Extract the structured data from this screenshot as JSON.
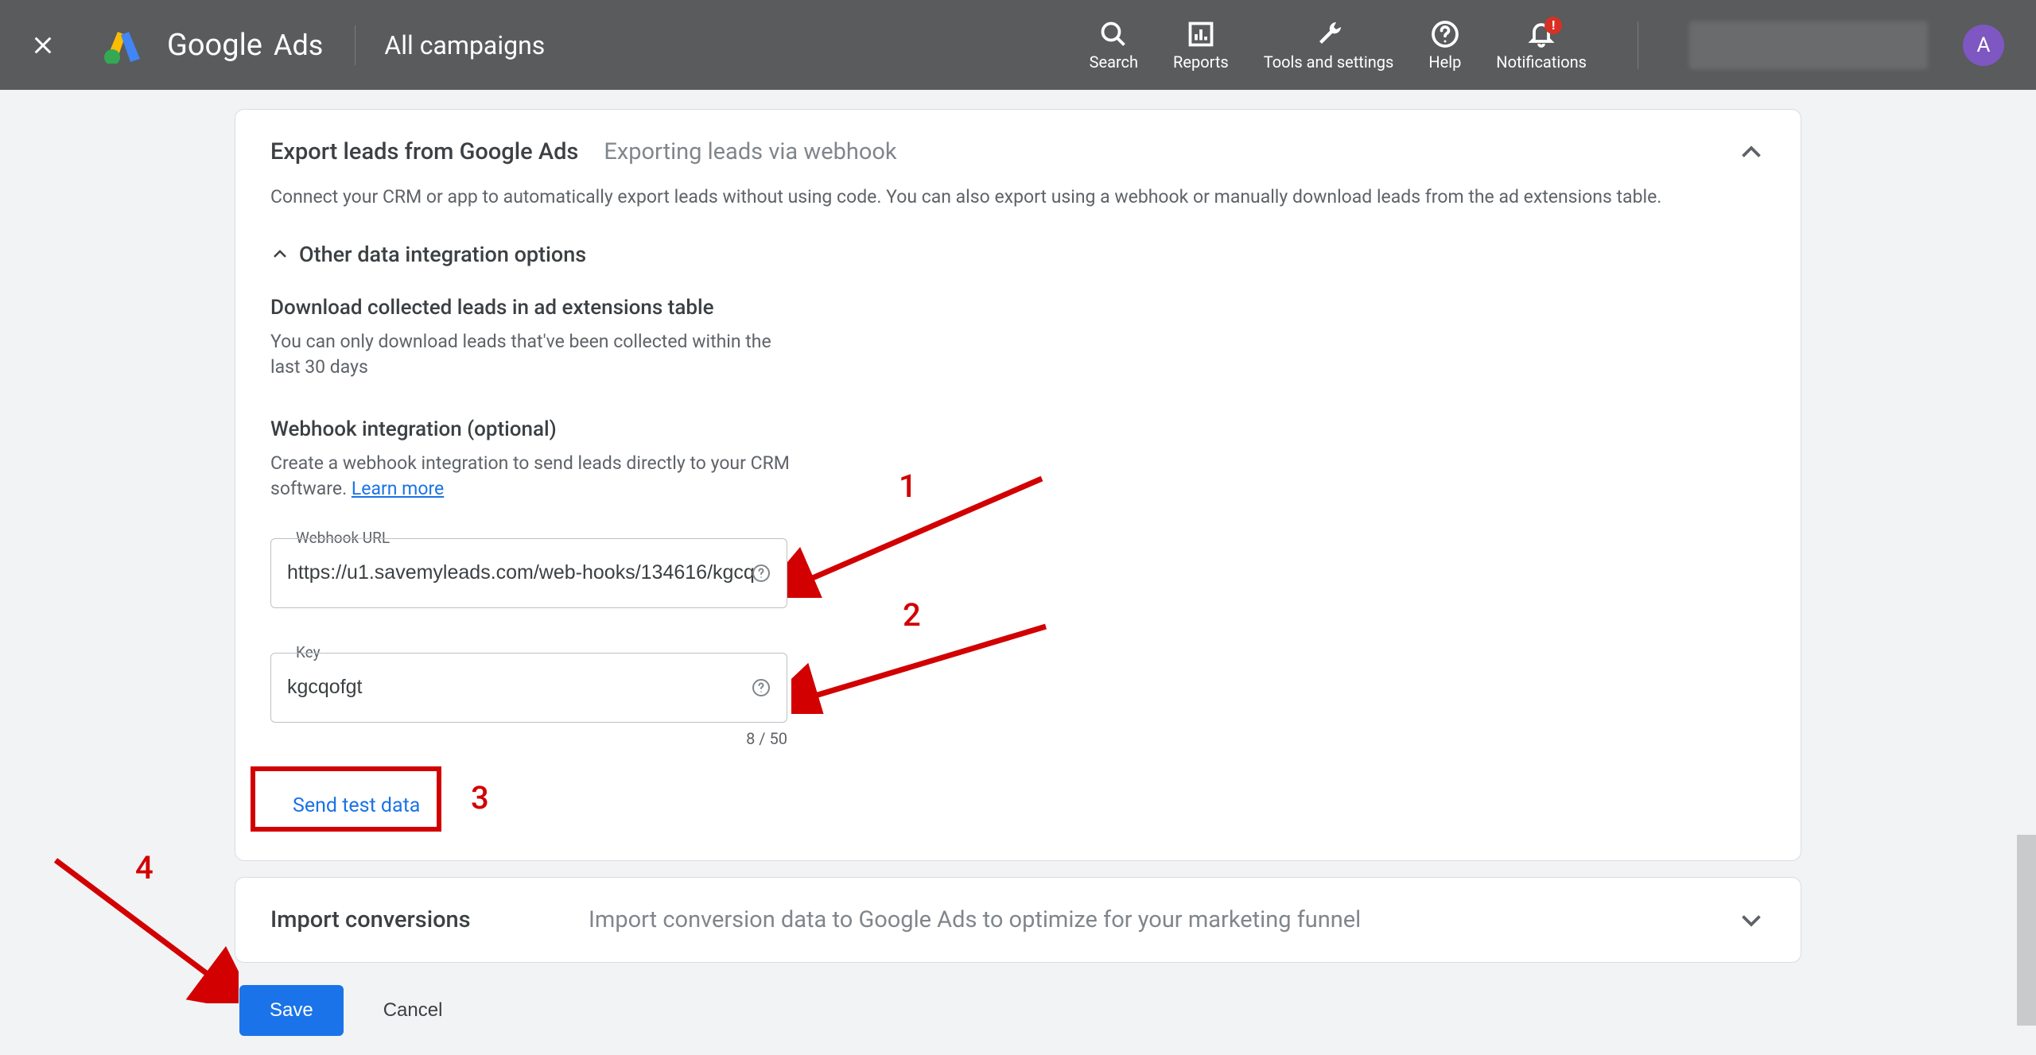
{
  "header": {
    "logo_google": "Google",
    "logo_ads": "Ads",
    "all_campaigns": "All campaigns",
    "items": {
      "search": "Search",
      "reports": "Reports",
      "tools": "Tools and settings",
      "help": "Help",
      "notifications": "Notifications",
      "notif_badge": "!"
    },
    "avatar": "A"
  },
  "card": {
    "title": "Export leads from Google Ads",
    "subtitle": "Exporting leads via webhook",
    "desc": "Connect your CRM or app to automatically export leads without using code. You can also export using a webhook or manually download leads from the ad extensions table.",
    "other_options": "Other data integration options",
    "download_heading": "Download collected leads in ad extensions table",
    "download_desc": "You can only download leads that've been collected within the last 30 days",
    "webhook_heading": "Webhook integration (optional)",
    "webhook_desc_pre": "Create a webhook integration to send leads directly to your CRM software. ",
    "learn_more": "Learn more",
    "webhook_url_label": "Webhook URL",
    "webhook_url_value": "https://u1.savemyleads.com/web-hooks/134616/kgcq",
    "key_label": "Key",
    "key_value": "kgcqofgt",
    "char_count": "8 / 50",
    "send_test": "Send test data"
  },
  "card2": {
    "title": "Import conversions",
    "desc": "Import conversion data to Google Ads to optimize for your marketing funnel"
  },
  "buttons": {
    "save": "Save",
    "cancel": "Cancel"
  },
  "annotations": {
    "a1": "1",
    "a2": "2",
    "a3": "3",
    "a4": "4"
  }
}
